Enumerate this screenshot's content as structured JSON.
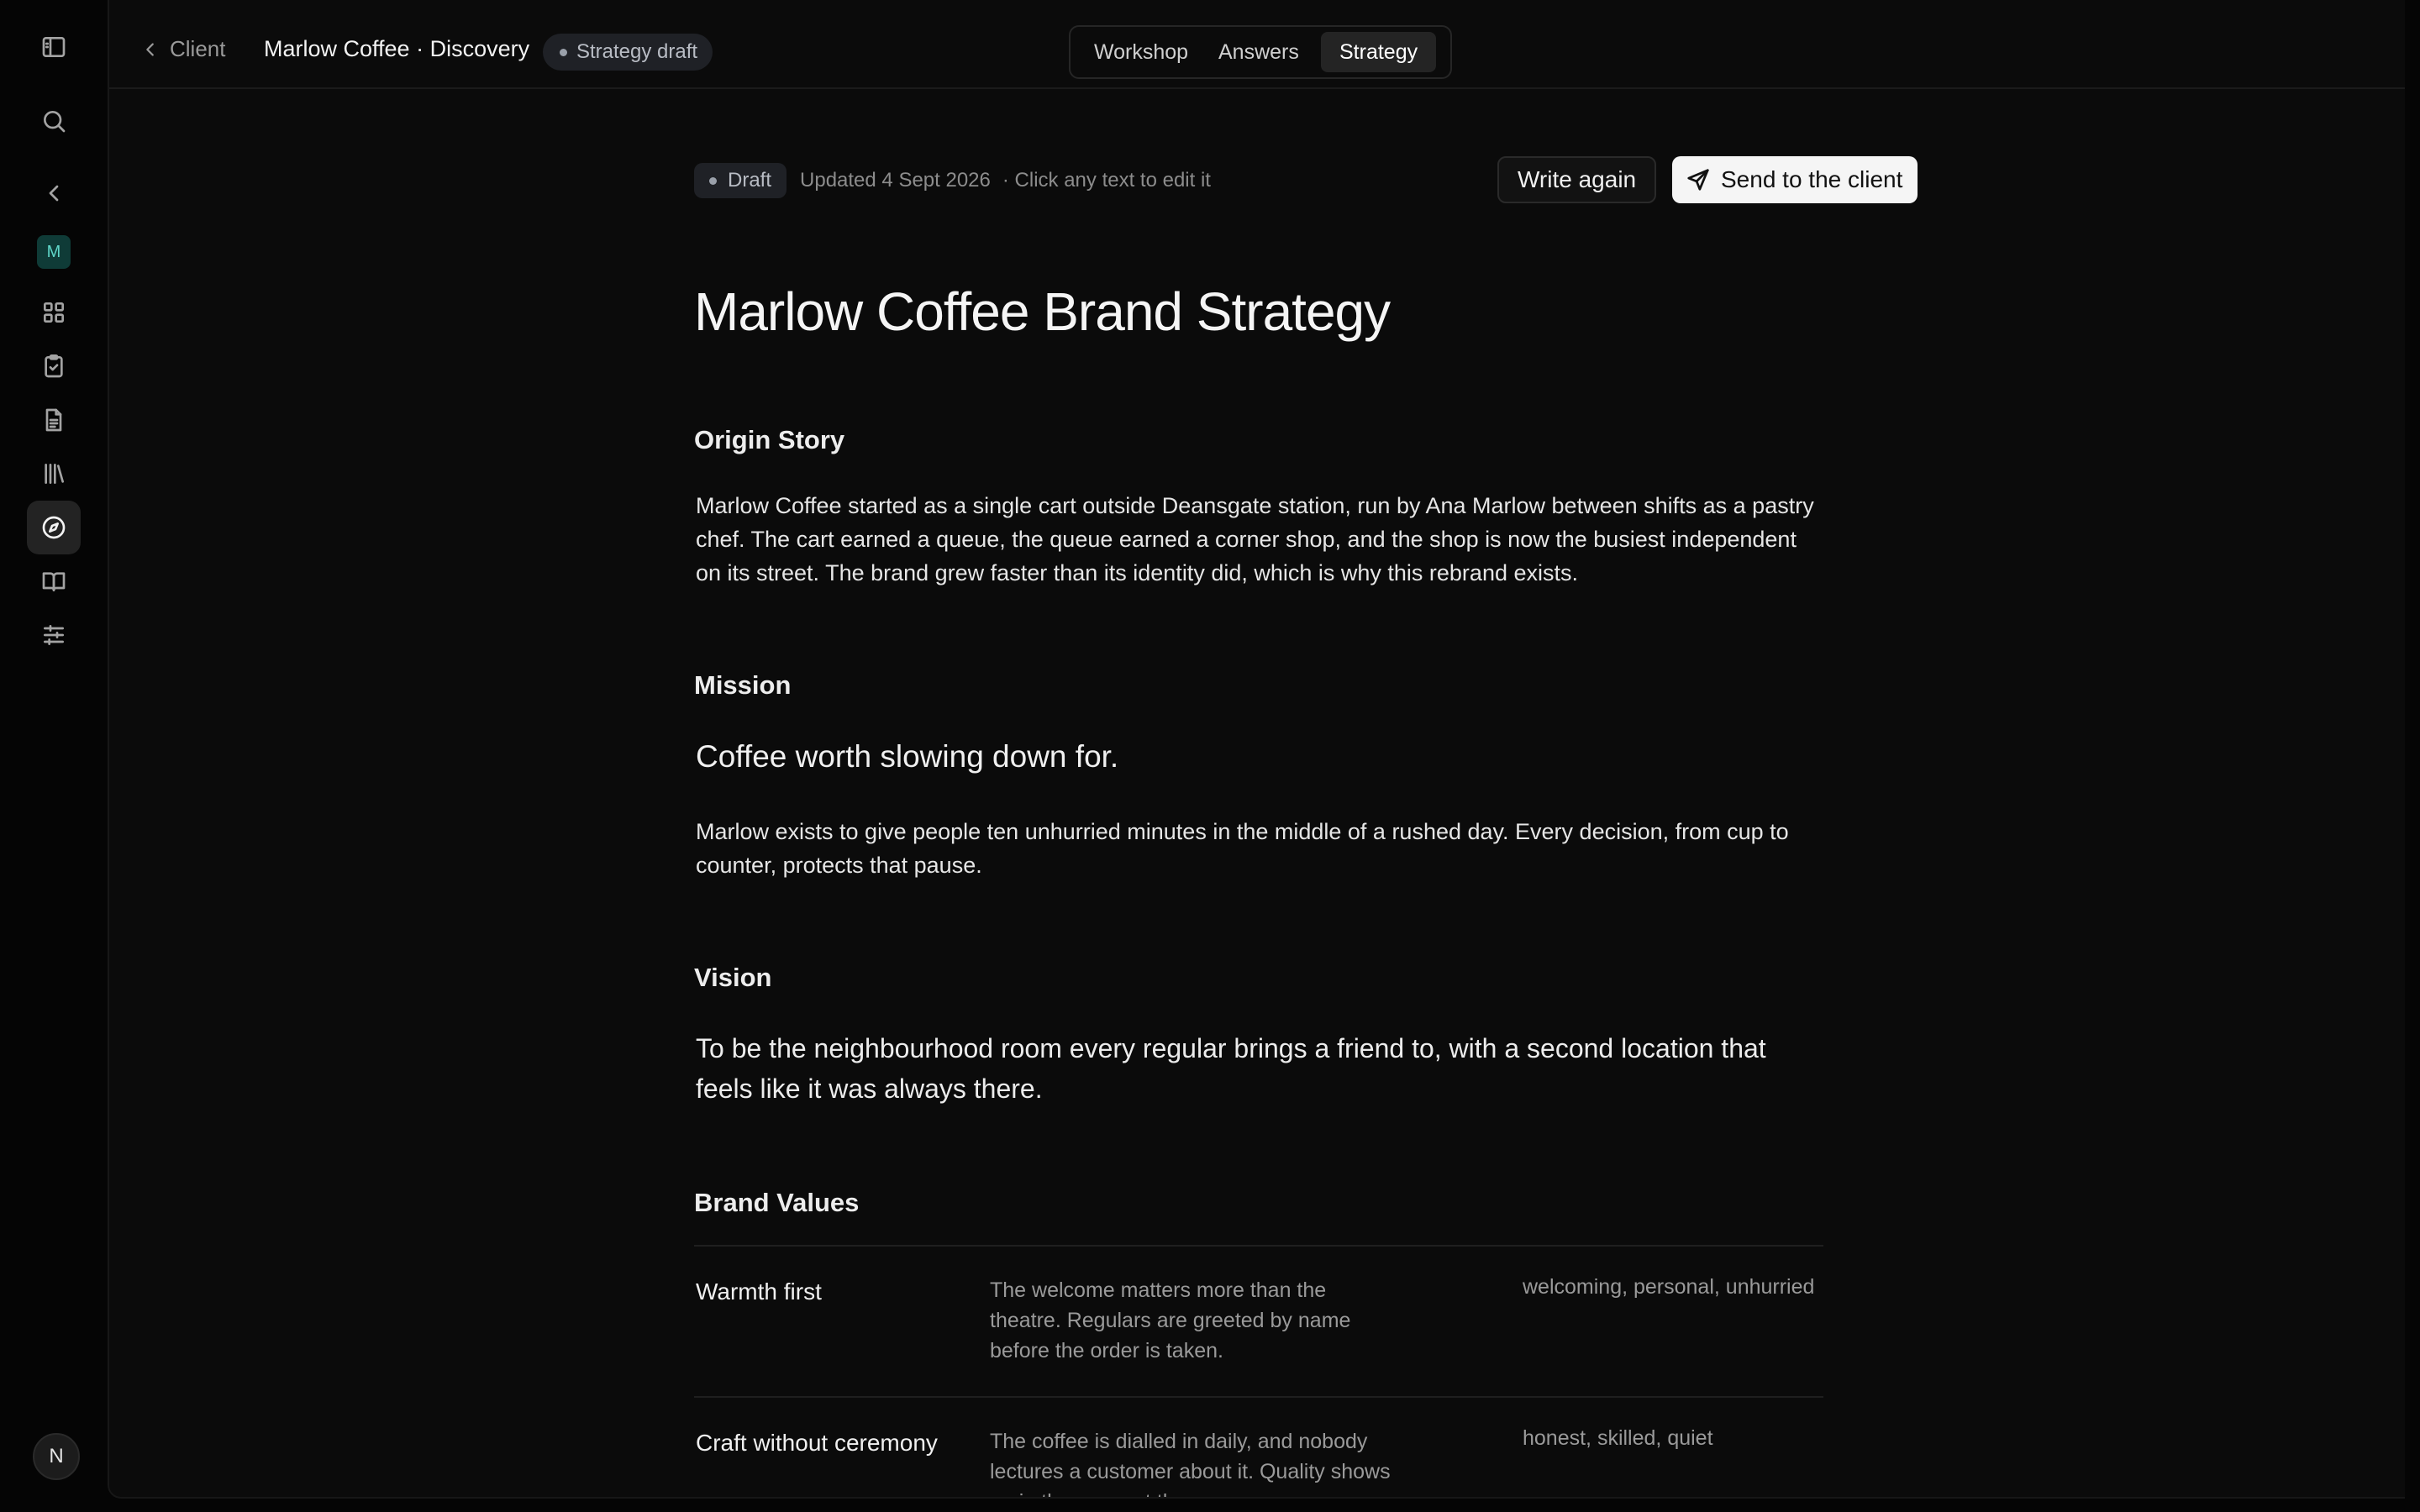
{
  "rail": {
    "workspace_initial": "M",
    "user_initial": "N",
    "items": [
      {
        "icon": "sidebar-toggle-icon"
      },
      {
        "icon": "search-icon"
      },
      {
        "icon": "chevron-left-icon"
      },
      {
        "icon": "grid-icon"
      },
      {
        "icon": "clipboard-check-icon"
      },
      {
        "icon": "document-icon"
      },
      {
        "icon": "library-icon"
      },
      {
        "icon": "compass-icon",
        "active": true
      },
      {
        "icon": "book-icon"
      },
      {
        "icon": "sliders-icon"
      }
    ]
  },
  "header": {
    "back_label": "Client",
    "project_title": "Marlow Coffee · Discovery",
    "status": "Strategy draft",
    "tabs": [
      {
        "label": "Workshop",
        "active": false
      },
      {
        "label": "Answers",
        "active": false
      },
      {
        "label": "Strategy",
        "active": true
      }
    ]
  },
  "doc": {
    "badge": "Draft",
    "updated": "Updated 4 Sept 2026",
    "hint": "· Click any text to edit it",
    "write_again": "Write again",
    "send": "Send to the client",
    "title": "Marlow Coffee Brand Strategy",
    "origin": {
      "heading": "Origin Story",
      "text": "Marlow Coffee started as a single cart outside Deansgate station, run by Ana Marlow between shifts as a pastry chef. The cart earned a queue, the queue earned a corner shop, and the shop is now the busiest independent on its street. The brand grew faster than its identity did, which is why this rebrand exists."
    },
    "mission": {
      "heading": "Mission",
      "statement": "Coffee worth slowing down for.",
      "text": "Marlow exists to give people ten unhurried minutes in the middle of a rushed day. Every decision, from cup to counter, protects that pause."
    },
    "vision": {
      "heading": "Vision",
      "statement": "To be the neighbourhood room every regular brings a friend to, with a second location that feels like it was always there."
    },
    "values": {
      "heading": "Brand Values",
      "rows": [
        {
          "name": "Warmth first",
          "description": "The welcome matters more than the theatre. Regulars are greeted by name before the order is taken.",
          "words": "welcoming, personal, unhurried"
        },
        {
          "name": "Craft without ceremony",
          "description": "The coffee is dialled in daily, and nobody lectures a customer about it. Quality shows up in the cup, not the",
          "words": "honest, skilled, quiet"
        }
      ]
    }
  }
}
